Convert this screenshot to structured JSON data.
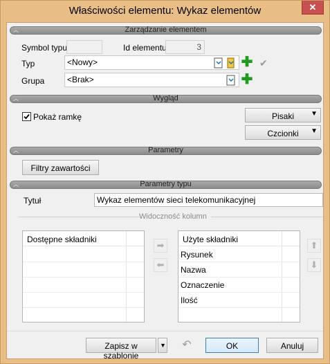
{
  "window": {
    "title": "Właściwości elementu: Wykaz elementów",
    "close_glyph": "✕"
  },
  "sections": {
    "management": "Zarządzanie elementem",
    "appearance": "Wygląd",
    "parameters": "Parametry",
    "type_parameters": "Parametry typu"
  },
  "management": {
    "symbol_label": "Symbol typu",
    "symbol_value": "",
    "id_label": "Id elementu",
    "id_value": "3",
    "type_label": "Typ",
    "type_value": "<Nowy>",
    "group_label": "Grupa",
    "group_value": "<Brak>"
  },
  "appearance": {
    "show_frame_label": "Pokaż ramkę",
    "show_frame_checked": true,
    "pens_label": "Pisaki",
    "fonts_label": "Czcionki"
  },
  "parameters": {
    "content_filters_label": "Filtry zawartości"
  },
  "type_params": {
    "title_label": "Tytuł",
    "title_value": "Wykaz elementów sieci telekomunikacyjnej",
    "columns_visibility_label": "Widoczność kolumn",
    "available_header": "Dostępne składniki",
    "available_items": [],
    "used_header": "Użyte składniki",
    "used_items": [
      "Rysunek",
      "Nazwa",
      "Oznaczenie",
      "Ilość"
    ]
  },
  "footer": {
    "save_template_label": "Zapisz w szablonie",
    "ok_label": "OK",
    "cancel_label": "Anuluj"
  },
  "icons": {
    "section_chevron": "chevron-up-icon",
    "plus": "plus-icon",
    "check": "check-icon",
    "arrow_right": "arrow-right-icon",
    "arrow_left": "arrow-left-icon",
    "arrow_up": "arrow-up-icon",
    "arrow_down": "arrow-down-icon",
    "undo": "undo-icon"
  },
  "colors": {
    "frame": "#e9be86",
    "section_bar": "#9a9a9a",
    "plus_green": "#1e9a1e",
    "ok_highlight": "#3c7fb1"
  }
}
